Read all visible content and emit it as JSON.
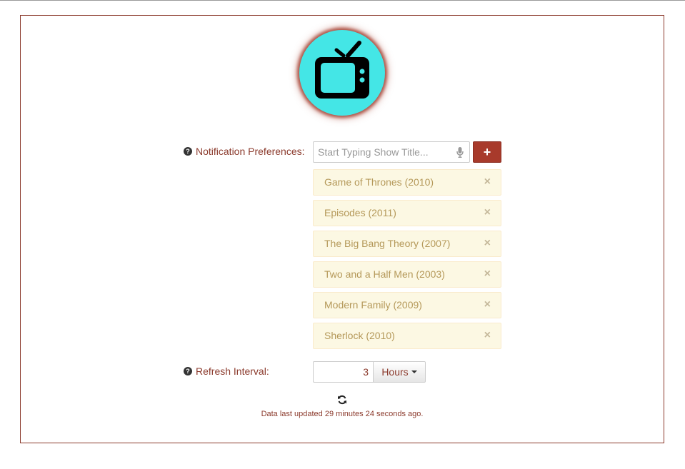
{
  "notification": {
    "label": "Notification Preferences:",
    "search_placeholder": "Start Typing Show Title...",
    "add_label": "+",
    "shows": [
      {
        "title": "Game of Thrones (2010)"
      },
      {
        "title": "Episodes (2011)"
      },
      {
        "title": "The Big Bang Theory (2007)"
      },
      {
        "title": "Two and a Half Men (2003)"
      },
      {
        "title": "Modern Family (2009)"
      },
      {
        "title": "Sherlock (2010)"
      }
    ],
    "remove_symbol": "×"
  },
  "refresh": {
    "label": "Refresh Interval:",
    "value": "3",
    "unit": "Hours",
    "status": "Data last updated 29 minutes 24 seconds ago."
  },
  "colors": {
    "accent": "#a83a2b",
    "logo_bg": "#44e6e6",
    "item_bg": "#fcf8e3",
    "item_text": "#b5995a"
  },
  "icons": {
    "logo": "tv-icon",
    "help": "question-circle-icon",
    "mic": "microphone-icon",
    "refresh": "refresh-icon"
  }
}
